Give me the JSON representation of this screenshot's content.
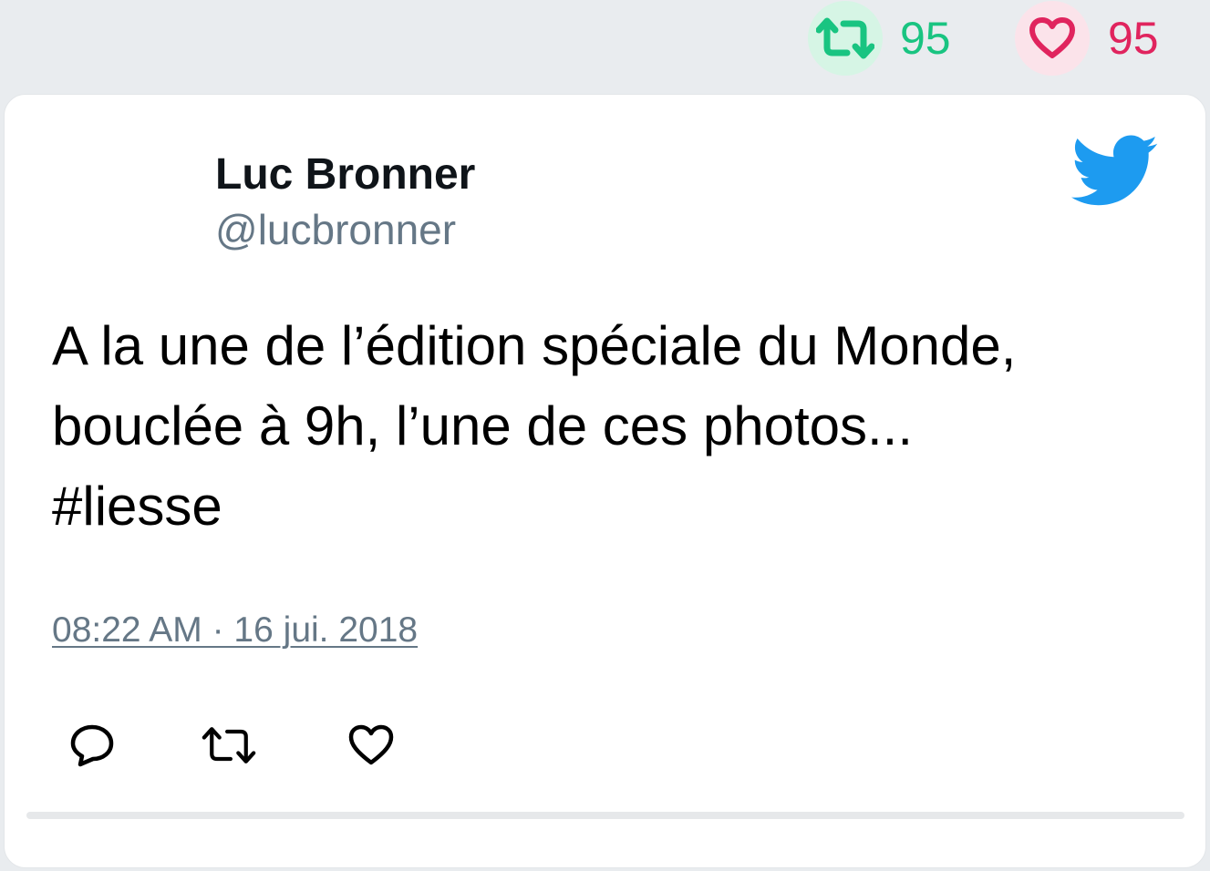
{
  "stats": {
    "retweets": "95",
    "likes": "95"
  },
  "tweet": {
    "author_name": "Luc Bronner",
    "author_handle": "@lucbronner",
    "text": "A la une de l’édition spéciale du Monde,\nbouclée à 9h, l’une de ces photos...\n#liesse",
    "timestamp": "08:22 AM · 16 jui. 2018"
  },
  "colors": {
    "retweet_green": "#19c481",
    "like_red": "#e0245e",
    "twitter_blue": "#1d9bf0",
    "muted_gray": "#657786"
  },
  "icons": {
    "brand": "twitter-bird-icon",
    "actions": [
      "reply-icon",
      "retweet-icon",
      "like-icon"
    ]
  }
}
